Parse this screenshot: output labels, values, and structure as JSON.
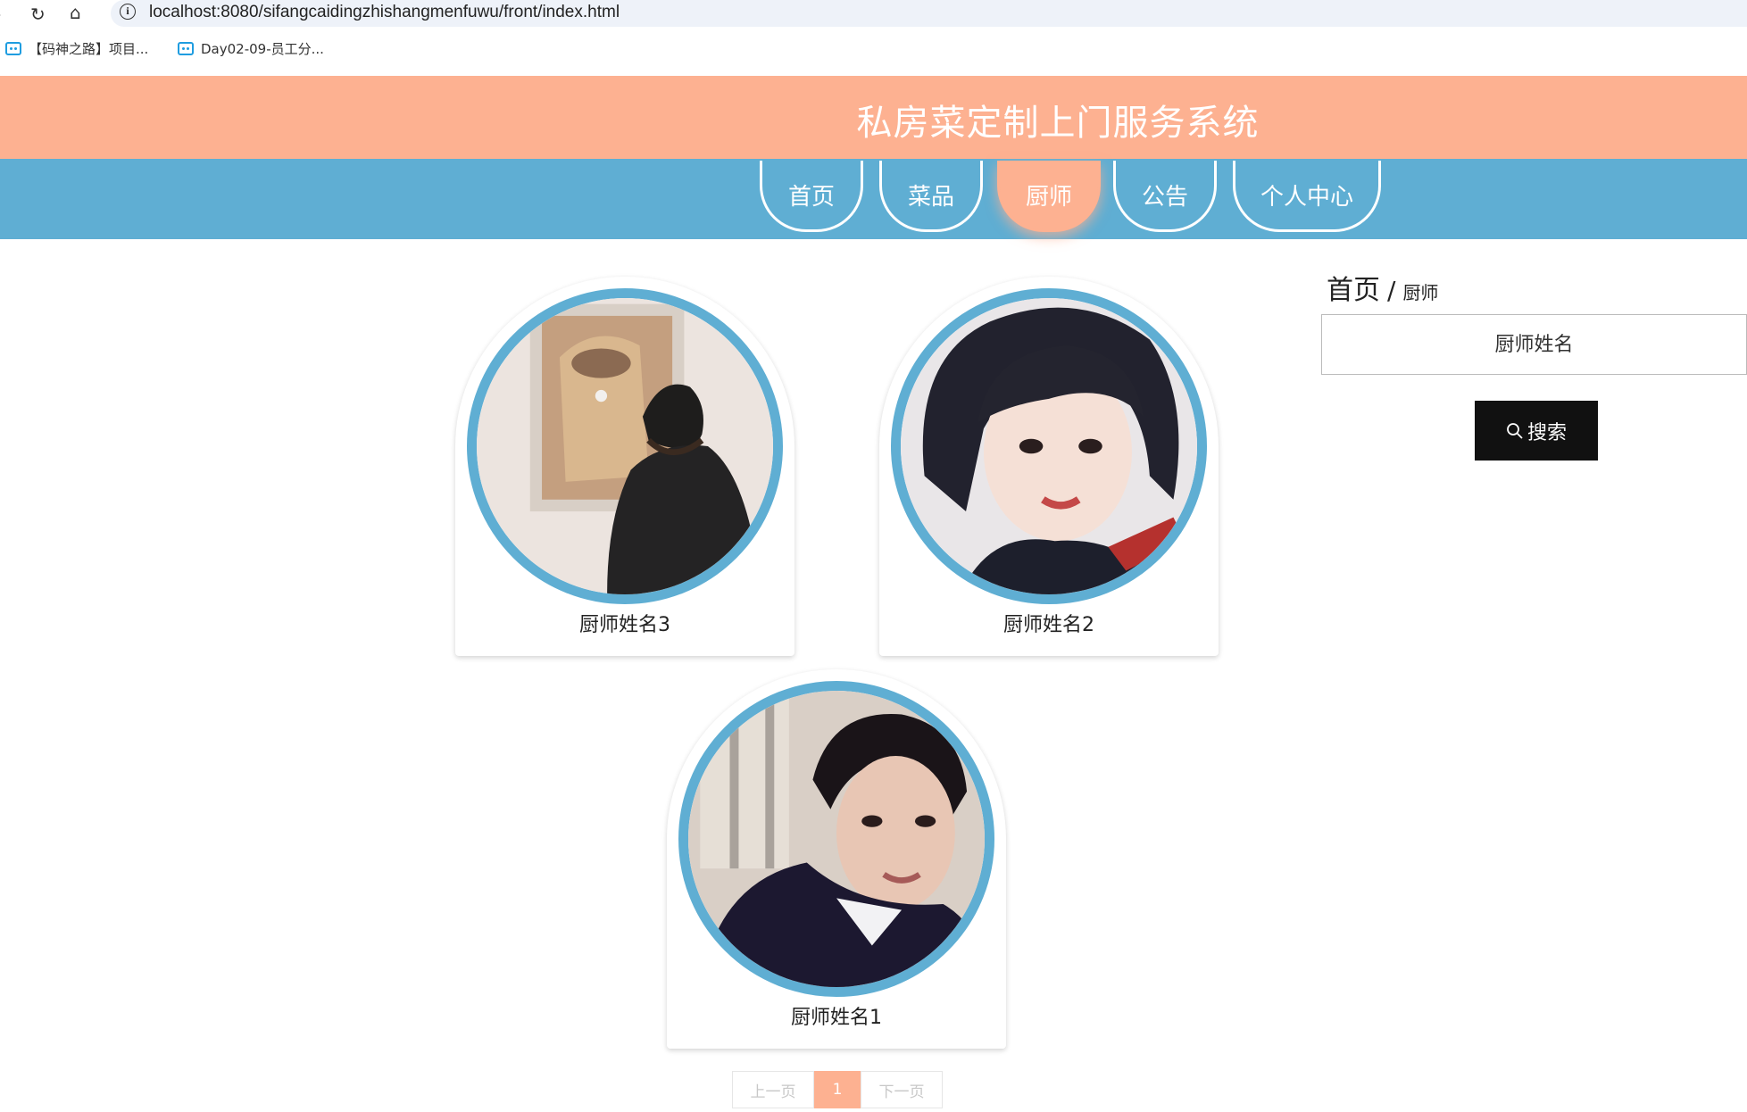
{
  "browser": {
    "url": "localhost:8080/sifangcaidingzhishangmenfuwu/front/index.html",
    "bookmarks": [
      "【码神之路】项目...",
      "Day02-09-员工分..."
    ]
  },
  "header": {
    "title": "私房菜定制上门服务系统"
  },
  "nav": {
    "items": [
      {
        "label": "首页"
      },
      {
        "label": "菜品"
      },
      {
        "label": "厨师"
      },
      {
        "label": "公告"
      },
      {
        "label": "个人中心"
      }
    ],
    "active": "厨师"
  },
  "chefs": [
    {
      "name": "厨师姓名3"
    },
    {
      "name": "厨师姓名2"
    },
    {
      "name": "厨师姓名1"
    }
  ],
  "sidebar": {
    "breadcrumb": {
      "home": "首页",
      "separator": "/",
      "current": "厨师"
    },
    "search": {
      "placeholder": "厨师姓名",
      "button_label": "搜索"
    }
  },
  "pagination": {
    "prev_label": "上一页",
    "current_page": "1",
    "next_label": "下一页"
  },
  "colors": {
    "header": "#fdb191",
    "nav": "#5faed3",
    "accent": "#fdb191"
  }
}
